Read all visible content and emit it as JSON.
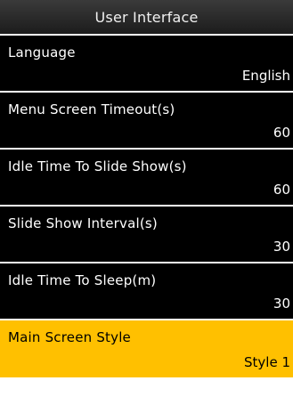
{
  "header": {
    "title": "User Interface"
  },
  "colors": {
    "header_bg": "#2a2a2a",
    "item_bg": "#000000",
    "selected_bg": "#ffc000"
  },
  "menu": {
    "items": [
      {
        "label": "Language",
        "value": "English",
        "selected": false
      },
      {
        "label": "Menu Screen Timeout(s)",
        "value": "60",
        "selected": false
      },
      {
        "label": "Idle Time To Slide Show(s)",
        "value": "60",
        "selected": false
      },
      {
        "label": "Slide Show Interval(s)",
        "value": "30",
        "selected": false
      },
      {
        "label": "Idle Time To Sleep(m)",
        "value": "30",
        "selected": false
      },
      {
        "label": "Main Screen Style",
        "value": "Style 1",
        "selected": true
      }
    ]
  }
}
